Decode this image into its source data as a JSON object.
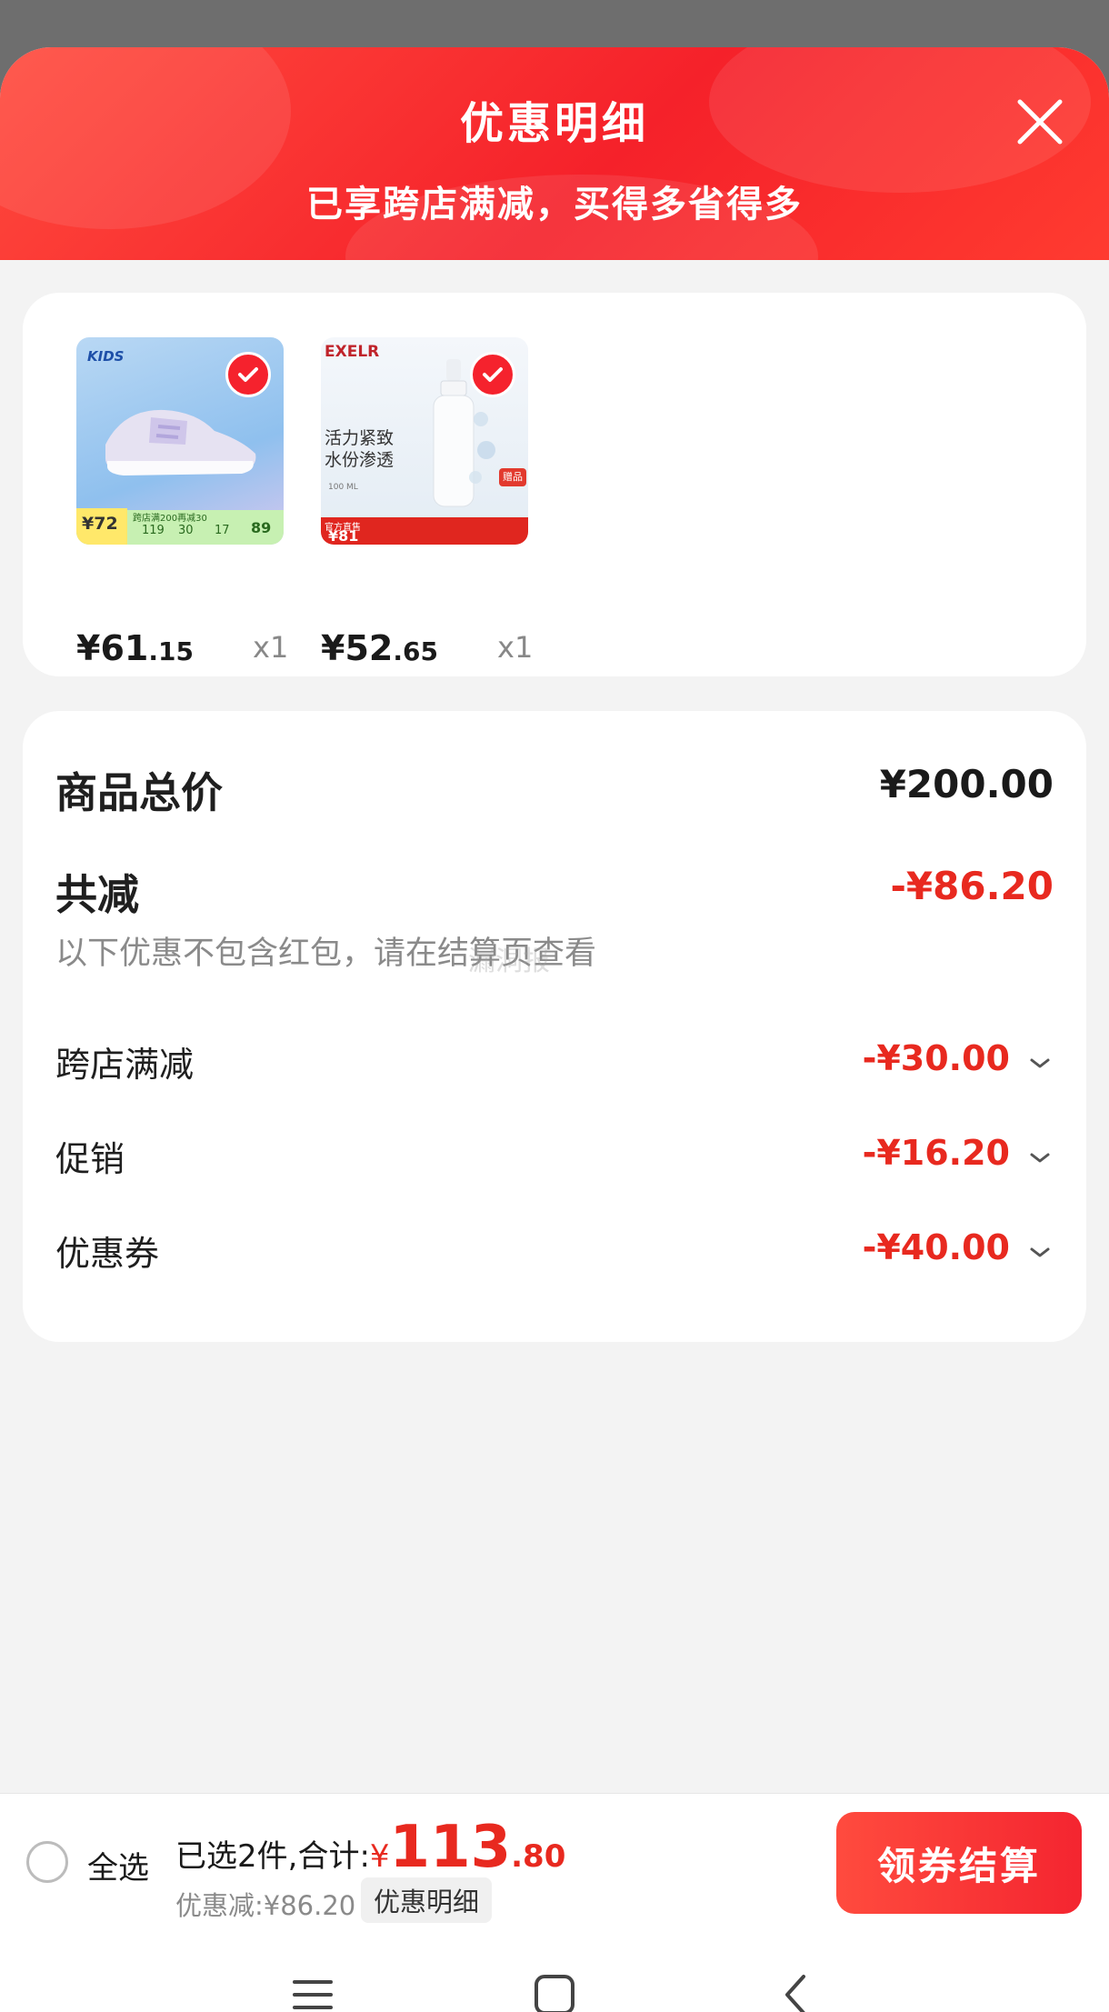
{
  "header": {
    "title": "优惠明细",
    "subtitle": "已享跨店满减，买得多省得多"
  },
  "products": [
    {
      "price_int": "¥61",
      "price_dec": ".15",
      "qty": "x1",
      "thumb": {
        "brand": "KIDS",
        "promo": "跨店满200再减30",
        "price_tag": "¥72",
        "stats": [
          "119",
          "30",
          "17",
          "89"
        ]
      }
    },
    {
      "price_int": "¥52",
      "price_dec": ".65",
      "qty": "x1",
      "thumb": {
        "brand": "EXELR",
        "line1": "活力紧致",
        "line2": "水份渗透",
        "volume": "100 ML",
        "badge": "赠品",
        "price_tag": "¥81",
        "official": "官方直售"
      }
    }
  ],
  "summary": {
    "total_label": "商品总价",
    "total_value": "¥200.00",
    "reduce_label": "共减",
    "reduce_value": "-¥86.20",
    "note": "以下优惠不包含红包，请在结算页查看",
    "watermark": "漏洞报",
    "items": [
      {
        "label": "跨店满减",
        "value": "-¥30.00"
      },
      {
        "label": "促销",
        "value": "-¥16.20"
      },
      {
        "label": "优惠券",
        "value": "-¥40.00"
      }
    ]
  },
  "bottom": {
    "select_all": "全选",
    "selected_prefix": "已选2件,合计:",
    "yen": "¥",
    "total_int": "113",
    "total_dec": ".80",
    "saved": "优惠减:¥86.20",
    "detail_button": "优惠明细",
    "checkout_button": "领券结算"
  },
  "colors": {
    "accent_red": "#e8291f",
    "header_red": "#f5212a",
    "background": "#f3f3f3"
  },
  "icons": {
    "close": "close-icon",
    "check": "checkmark-icon",
    "chevron": "chevron-down-icon",
    "menu": "menu-icon",
    "home": "home-square-icon",
    "back": "back-arrow-icon"
  }
}
